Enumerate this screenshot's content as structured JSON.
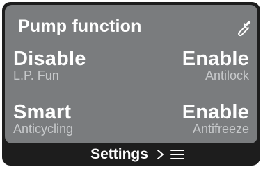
{
  "screen": {
    "title": "Pump function",
    "settings_icon": "wrench-icon"
  },
  "functions": [
    {
      "value": "Disable",
      "label": "L.P. Fun"
    },
    {
      "value": "Enable",
      "label": "Antilock"
    },
    {
      "value": "Smart",
      "label": "Anticycling"
    },
    {
      "value": "Enable",
      "label": "Antifreeze"
    }
  ],
  "footer": {
    "label": "Settings",
    "chevron_icon": "chevron-right-icon",
    "menu_icon": "menu-icon"
  },
  "colors": {
    "panel": "#7a7c7e",
    "bezel": "#1d1d1d",
    "text": "#ffffff",
    "subtext": "#c7c9cb"
  }
}
